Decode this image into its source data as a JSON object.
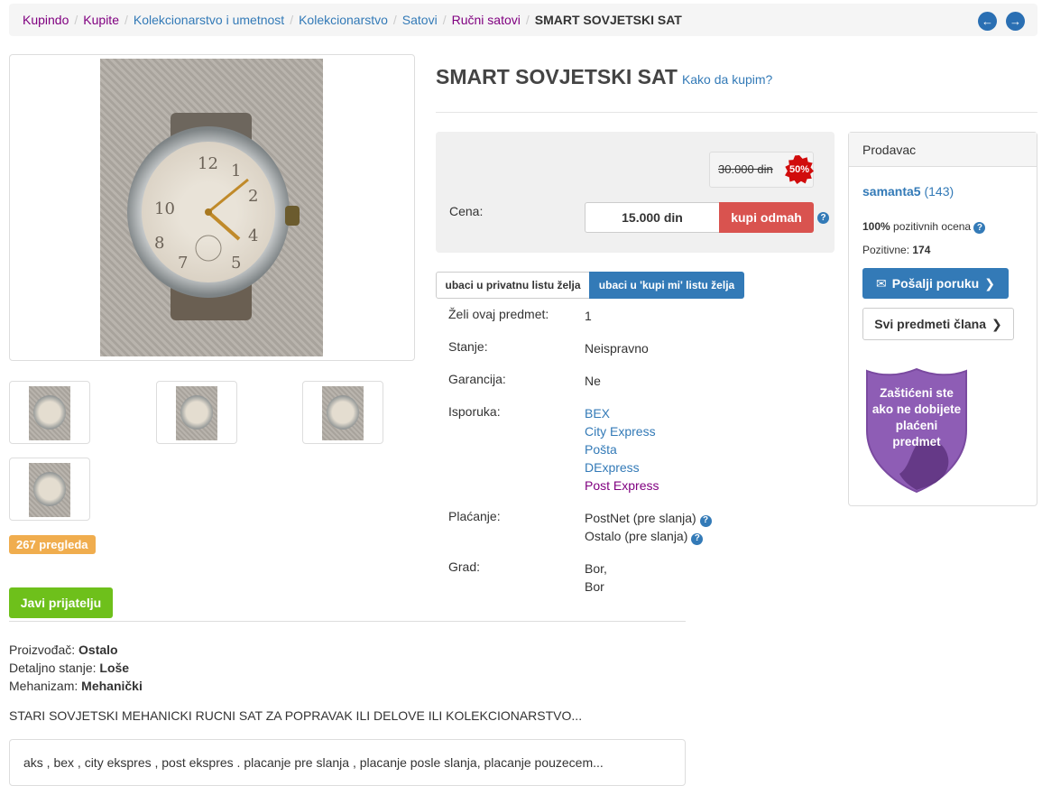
{
  "breadcrumb": {
    "items": [
      {
        "label": "Kupindo",
        "style": "purple"
      },
      {
        "label": "Kupite",
        "style": "purple"
      },
      {
        "label": "Kolekcionarstvo i umetnost",
        "style": "blue"
      },
      {
        "label": "Kolekcionarstvo",
        "style": "blue"
      },
      {
        "label": "Satovi",
        "style": "blue"
      },
      {
        "label": "Ručni satovi",
        "style": "purple"
      }
    ],
    "active": "SMART SOVJETSKI SAT"
  },
  "nav": {
    "prev_icon": "arrow-left-icon",
    "next_icon": "arrow-right-icon"
  },
  "title": "SMART SOVJETSKI SAT",
  "how_to_buy": "Kako da kupim?",
  "gallery": {
    "thumbnail_count": 4
  },
  "views_badge": "267 pregleda",
  "tell_friend": "Javi prijatelju",
  "attributes": [
    {
      "label": "Proizvođač:",
      "value": "Ostalo"
    },
    {
      "label": "Detaljno stanje:",
      "value": "Loše"
    },
    {
      "label": "Mehanizam:",
      "value": "Mehanički"
    }
  ],
  "description": "STARI SOVJETSKI MEHANICKI RUCNI SAT ZA POPRAVAK ILI DELOVE ILI KOLEKCIONARSTVO...",
  "shipping_note": "aks , bex , city ekspres , post ekspres . placanje pre slanja , placanje posle slanja, placanje pouzecem...",
  "price": {
    "old_price": "30.000 din",
    "discount": "50%",
    "label": "Cena:",
    "current": "15.000 din",
    "buy_now": "kupi odmah"
  },
  "wishlist": {
    "private": "ubaci u privatnu listu želja",
    "buy": "ubaci u 'kupi mi' listu želja"
  },
  "details": {
    "wants": {
      "label": "Želi ovaj predmet:",
      "value": "1"
    },
    "condition": {
      "label": "Stanje:",
      "value": "Neispravno"
    },
    "warranty": {
      "label": "Garancija:",
      "value": "Ne"
    },
    "delivery": {
      "label": "Isporuka:",
      "options": [
        "BEX",
        "City Express",
        "Pošta",
        "DExpress",
        "Post Express"
      ]
    },
    "payment": {
      "label": "Plaćanje:",
      "options": [
        "PostNet (pre slanja)",
        "Ostalo (pre slanja)"
      ]
    },
    "city": {
      "label": "Grad:",
      "values": [
        "Bor,",
        "Bor"
      ]
    }
  },
  "seller": {
    "header": "Prodavac",
    "name": "samanta5",
    "score": "(143)",
    "positive_pct": "100%",
    "positive_label": "pozitivnih ocena",
    "positive_count_label": "Pozitivne:",
    "positive_count": "174",
    "message_btn": "Pošalji poruku",
    "all_items_btn": "Svi predmeti člana",
    "protection_text": "Zaštićeni ste ako ne dobijete plaćeni predmet"
  },
  "colors": {
    "primary": "#337ab7",
    "danger": "#d9534f",
    "success": "#6ec01b",
    "warning": "#f0ad4e",
    "shield": "#8e5db5"
  }
}
